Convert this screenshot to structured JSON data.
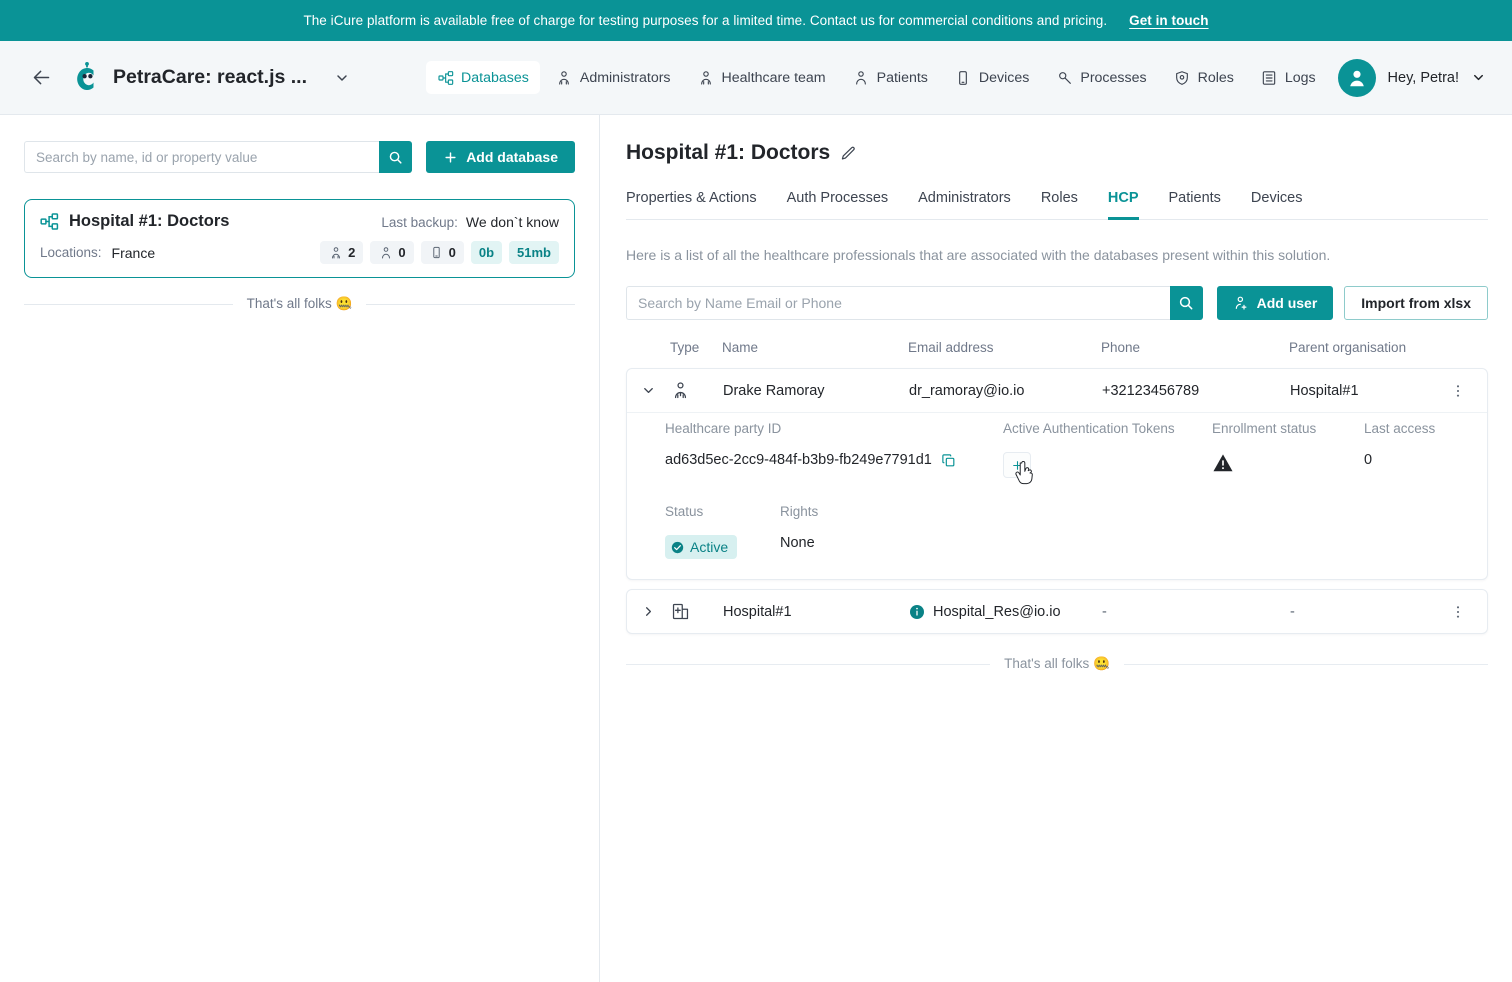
{
  "promo": {
    "text": "The iCure platform is available free of charge for testing purposes for a limited time. Contact us for commercial conditions and pricing.",
    "link_label": "Get in touch"
  },
  "header": {
    "brand_title": "PetraCare: react.js ...",
    "nav": [
      {
        "label": "Databases",
        "icon": "databases-icon",
        "active": true
      },
      {
        "label": "Administrators",
        "icon": "administrators-icon",
        "active": false
      },
      {
        "label": "Healthcare team",
        "icon": "healthcare-team-icon",
        "active": false
      },
      {
        "label": "Patients",
        "icon": "patients-icon",
        "active": false
      },
      {
        "label": "Devices",
        "icon": "devices-icon",
        "active": false
      },
      {
        "label": "Processes",
        "icon": "processes-icon",
        "active": false
      },
      {
        "label": "Roles",
        "icon": "roles-icon",
        "active": false
      },
      {
        "label": "Logs",
        "icon": "logs-icon",
        "active": false
      }
    ],
    "user_greeting": "Hey, Petra!"
  },
  "sidebar": {
    "search_placeholder": "Search by name, id or property value",
    "search_value": "",
    "add_database_label": "Add database",
    "database": {
      "name": "Hospital #1: Doctors",
      "backup_label": "Last backup:",
      "backup_value": "We don`t know",
      "locations_label": "Locations:",
      "locations_value": "France",
      "stats": [
        {
          "icon": "hcp-group-icon",
          "value": "2",
          "accent": false
        },
        {
          "icon": "patients-group-icon",
          "value": "0",
          "accent": false
        },
        {
          "icon": "device-icon",
          "value": "0",
          "accent": false
        },
        {
          "icon": "",
          "value": "0b",
          "accent": true
        },
        {
          "icon": "",
          "value": "51mb",
          "accent": true
        }
      ]
    },
    "end_of_list": "That's all folks 🤐"
  },
  "main": {
    "title": "Hospital #1: Doctors",
    "tabs": [
      {
        "label": "Properties & Actions",
        "active": false
      },
      {
        "label": "Auth Processes",
        "active": false
      },
      {
        "label": "Administrators",
        "active": false
      },
      {
        "label": "Roles",
        "active": false
      },
      {
        "label": "HCP",
        "active": true
      },
      {
        "label": "Patients",
        "active": false
      },
      {
        "label": "Devices",
        "active": false
      }
    ],
    "description": "Here is a list of all the healthcare professionals that are associated with the databases present within this solution.",
    "search_placeholder": "Search by Name Email or Phone",
    "search_value": "",
    "add_user_label": "Add user",
    "import_label": "Import from xlsx",
    "table": {
      "columns": [
        "Type",
        "Name",
        "Email address",
        "Phone",
        "Parent organisation"
      ],
      "rows": [
        {
          "expanded": true,
          "type_icon": "hcp-person-icon",
          "name": "Drake Ramoray",
          "email": "dr_ramoray@io.io",
          "email_has_info": false,
          "phone": "+32123456789",
          "parent_organisation": "Hospital#1",
          "detail": {
            "hpid_label": "Healthcare party ID",
            "hpid_value": "ad63d5ec-2cc9-484f-b3b9-fb249e7791d1",
            "tokens_label": "Active Authentication Tokens",
            "enrollment_label": "Enrollment status",
            "enrollment_status": "warning",
            "last_access_label": "Last access",
            "last_access_value": "0",
            "status_label": "Status",
            "status_value": "Active",
            "rights_label": "Rights",
            "rights_value": "None"
          }
        },
        {
          "expanded": false,
          "type_icon": "hospital-icon",
          "name": "Hospital#1",
          "email": "Hospital_Res@io.io",
          "email_has_info": true,
          "phone": "-",
          "parent_organisation": "-",
          "detail": null
        }
      ]
    },
    "end_of_list": "That's all folks 🤐"
  },
  "colors": {
    "brand_teal": "#0a9396",
    "banner_teal": "#0a9396",
    "header_bg": "#f4f7f9",
    "text": "#22252a",
    "muted": "#70798a",
    "badge_bg": "#d7f0f0"
  }
}
